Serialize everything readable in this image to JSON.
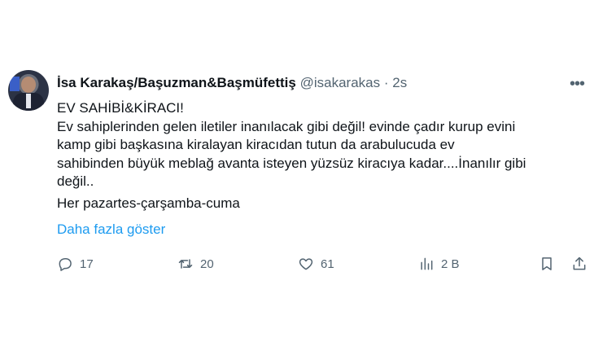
{
  "author": {
    "display_name": "İsa Karakaş/Başuzman&Başmüfettiş",
    "handle": "@isakarakas",
    "separator": "·",
    "time": "2s"
  },
  "tweet": {
    "lines": [
      "EV SAHİBİ&KİRACI!",
      "Ev sahiplerinden gelen iletiler inanılacak gibi değil! evinde çadır kurup evini",
      "kamp gibi başkasına kiralayan kiracıdan tutun da arabulucuda ev",
      "sahibinden büyük meblağ avanta isteyen yüzsüz kiracıya kadar....İnanılır gibi",
      "değil..",
      "Her pazartes-çarşamba-cuma"
    ],
    "show_more": "Daha fazla göster"
  },
  "actions": {
    "replies": "17",
    "reposts": "20",
    "likes": "61",
    "views": "2 B"
  },
  "colors": {
    "text": "#0f1419",
    "muted": "#536471",
    "link": "#1d9bf0"
  }
}
